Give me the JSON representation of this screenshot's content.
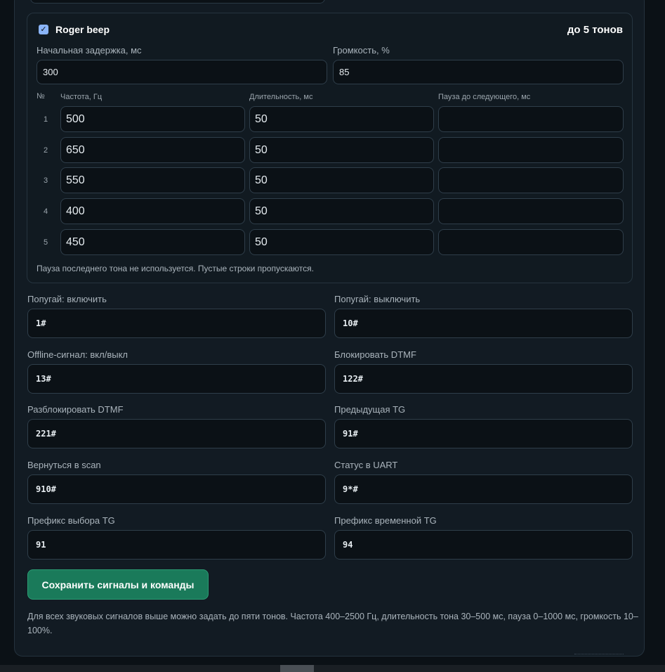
{
  "roger_beep": {
    "enabled": true,
    "title": "Roger beep",
    "tones_limit": "до 5 тонов",
    "initial_delay_label": "Начальная задержка, мс",
    "initial_delay_value": "300",
    "volume_label": "Громкость, %",
    "volume_value": "85",
    "columns": {
      "num": "№",
      "freq": "Частота, Гц",
      "dur": "Длительность, мс",
      "pause": "Пауза до следующего, мс"
    },
    "tones": [
      {
        "n": "1",
        "freq": "500",
        "dur": "50",
        "pause": ""
      },
      {
        "n": "2",
        "freq": "650",
        "dur": "50",
        "pause": ""
      },
      {
        "n": "3",
        "freq": "550",
        "dur": "50",
        "pause": ""
      },
      {
        "n": "4",
        "freq": "400",
        "dur": "50",
        "pause": ""
      },
      {
        "n": "5",
        "freq": "450",
        "dur": "50",
        "pause": ""
      }
    ],
    "note": "Пауза последнего тона не используется. Пустые строки пропускаются."
  },
  "commands": [
    {
      "label": "Попугай: включить",
      "value": "1#"
    },
    {
      "label": "Попугай: выключить",
      "value": "10#"
    },
    {
      "label": "Offline-сигнал: вкл/выкл",
      "value": "13#"
    },
    {
      "label": "Блокировать DTMF",
      "value": "122#"
    },
    {
      "label": "Разблокировать DTMF",
      "value": "221#"
    },
    {
      "label": "Предыдущая TG",
      "value": "91#"
    },
    {
      "label": "Вернуться в scan",
      "value": "910#"
    },
    {
      "label": "Статус в UART",
      "value": "9*#"
    },
    {
      "label": "Префикс выбора TG",
      "value": "91"
    },
    {
      "label": "Префикс временной TG",
      "value": "94"
    }
  ],
  "save_label": "Сохранить сигналы и команды",
  "footer_note": "Для всех звуковых сигналов выше можно задать до пяти тонов. Частота 400–2500 Гц, длительность тона 30–500 мс, пауза 0–1000 мс, громкость 10–100%."
}
